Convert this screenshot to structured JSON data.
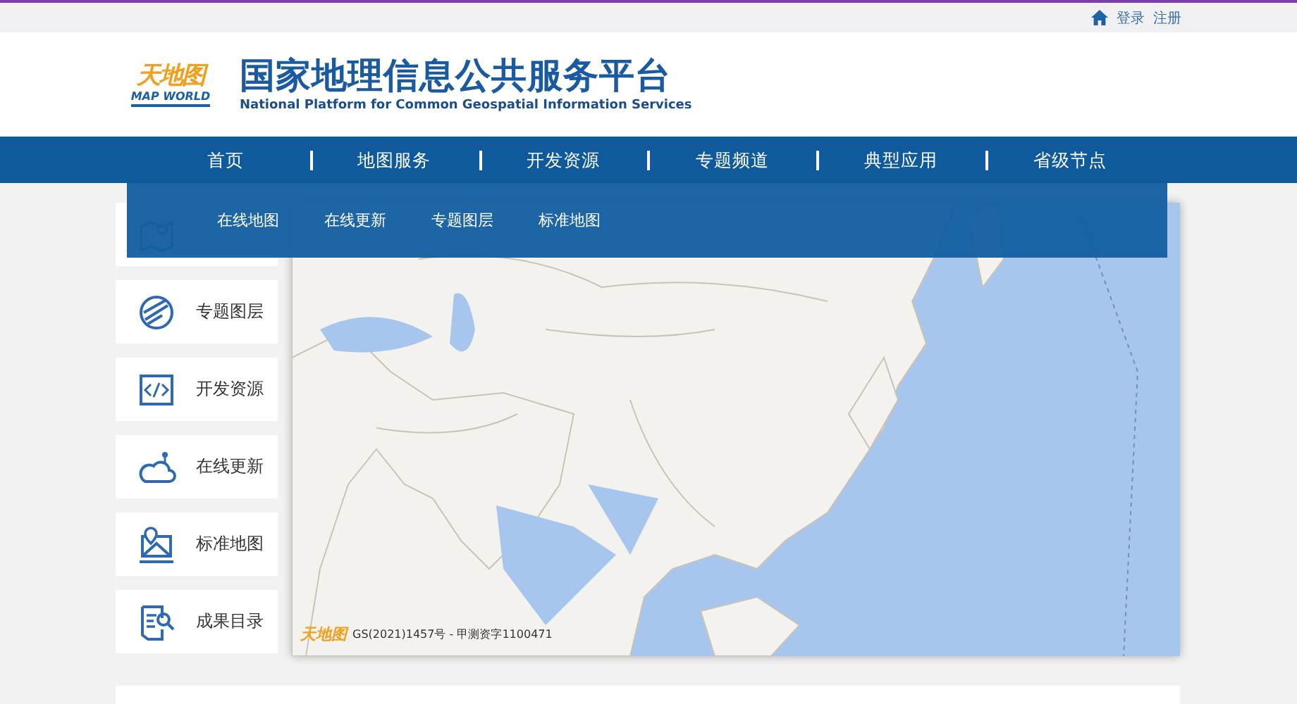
{
  "top_bar": {
    "links": [
      "登录",
      "注册"
    ]
  },
  "header": {
    "logo": {
      "mark": "天地图",
      "wordmark": "MAP WORLD"
    },
    "title": "国家地理信息公共服务平台",
    "subtitle": "National Platform for Common Geospatial Information Services"
  },
  "nav": [
    "首页",
    "地图服务",
    "开发资源",
    "专题频道",
    "典型应用",
    "省级节点"
  ],
  "dropdown": [
    "在线地图",
    "在线更新",
    "专题图层",
    "标准地图"
  ],
  "sidebar": [
    {
      "kind": "map"
    },
    {
      "kind": "layers",
      "label": "专题图层"
    },
    {
      "kind": "code",
      "label": "开发资源"
    },
    {
      "kind": "cloud",
      "label": "在线更新"
    },
    {
      "kind": "pinmap",
      "label": "标准地图"
    },
    {
      "kind": "catalog",
      "label": "成果目录"
    }
  ],
  "map": {
    "logo": "天地图",
    "attribution": "GS(2021)1457号 - 甲测资字1100471"
  }
}
